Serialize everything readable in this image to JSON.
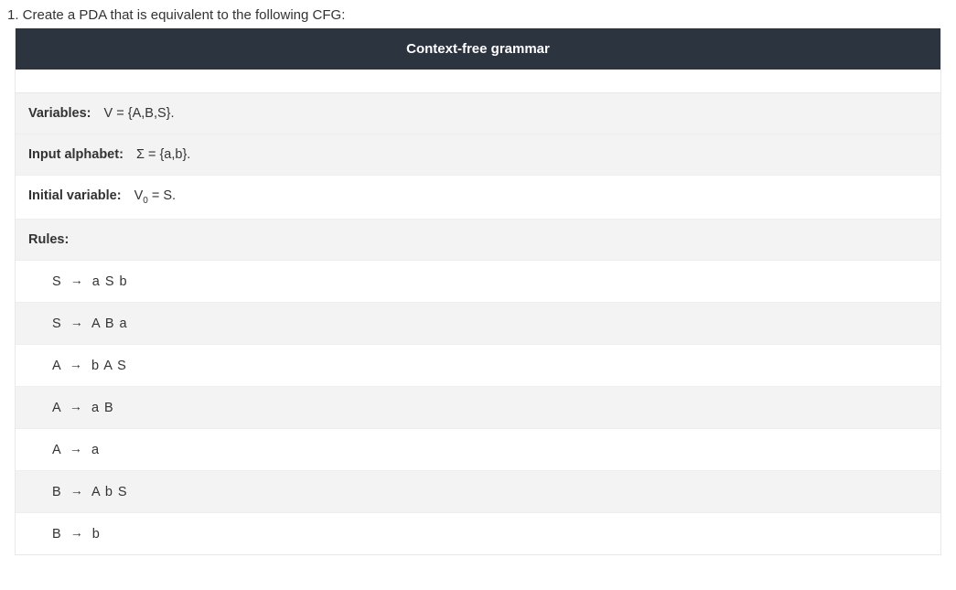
{
  "question": {
    "prompt": "1. Create a PDA that is equivalent to the following CFG:"
  },
  "header": {
    "title": "Context-free grammar"
  },
  "definition": {
    "variables": {
      "label": "Variables:",
      "value": "V = {A,B,S}."
    },
    "alphabet": {
      "label": "Input alphabet:",
      "value": "Σ = {a,b}."
    },
    "initial": {
      "label": "Initial variable:",
      "value_prefix": "V",
      "value_sub": "0",
      "value_suffix": " = S."
    },
    "rules_label": "Rules:"
  },
  "rules": [
    {
      "lhs": "S",
      "rhs": "a S b"
    },
    {
      "lhs": "S",
      "rhs": "A B a"
    },
    {
      "lhs": "A",
      "rhs": "b A S"
    },
    {
      "lhs": "A",
      "rhs": "a B"
    },
    {
      "lhs": "A",
      "rhs": "a"
    },
    {
      "lhs": "B",
      "rhs": "A b S"
    },
    {
      "lhs": "B",
      "rhs": "b"
    }
  ],
  "symbols": {
    "arrow": "→"
  }
}
